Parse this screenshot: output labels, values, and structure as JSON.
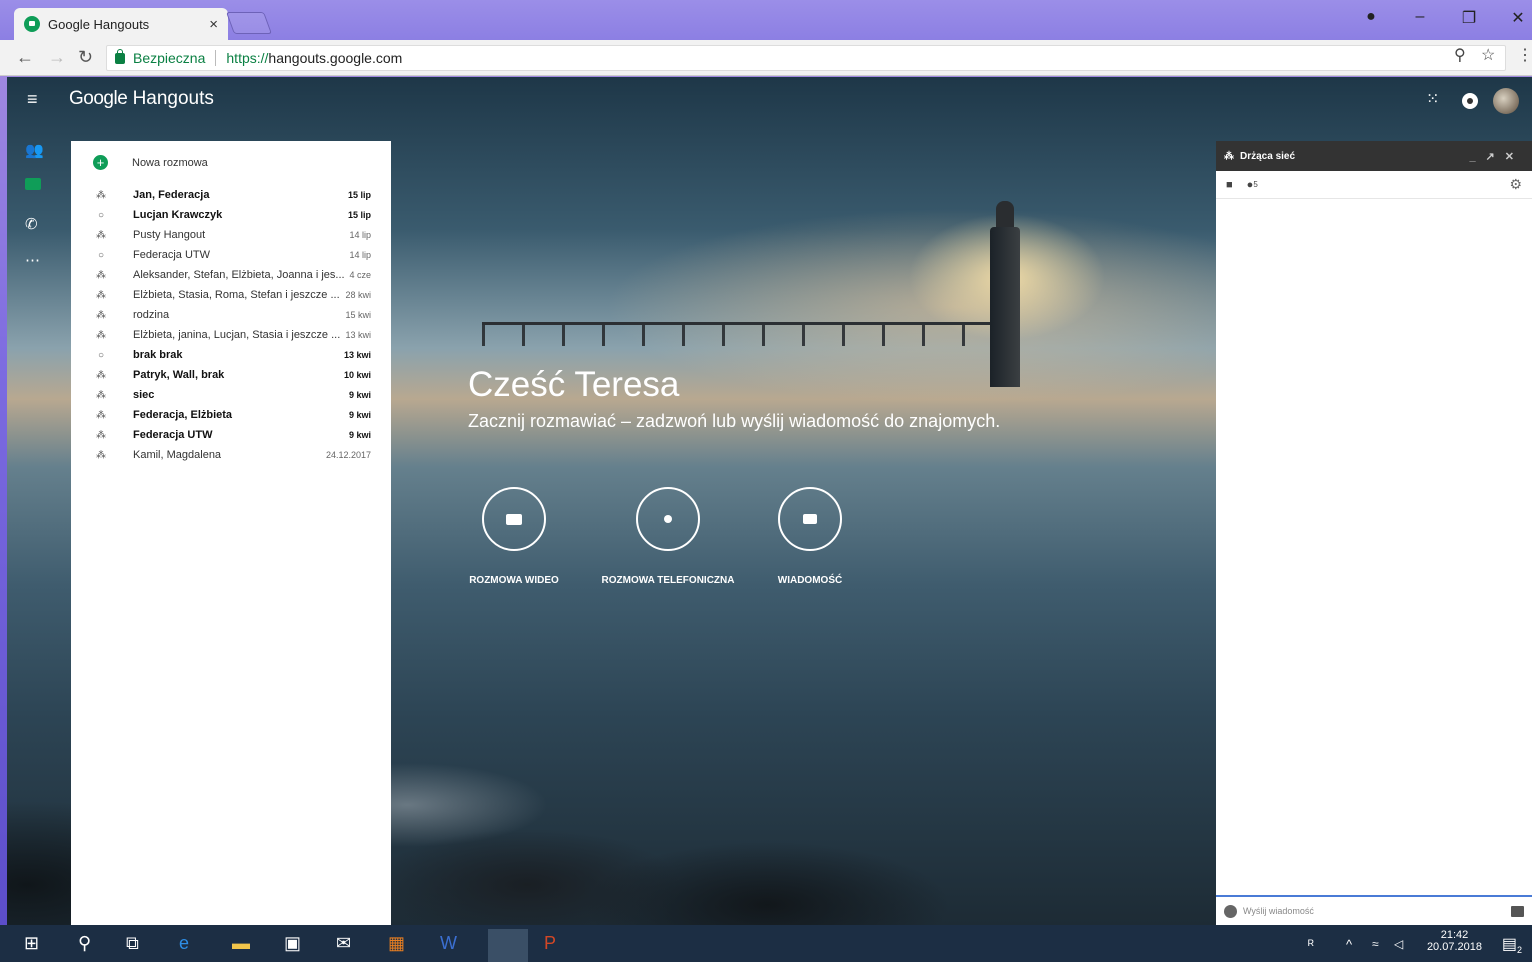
{
  "browser": {
    "tab_title": "Google Hangouts",
    "tab_close": "×",
    "secure_label": "Bezpieczna",
    "url_scheme": "https://",
    "url_host": "hangouts.google.com"
  },
  "app": {
    "brand_google": "Google",
    "brand_name": "Hangouts"
  },
  "sidebar": {
    "new_conversation": "Nowa rozmowa",
    "conversations": [
      {
        "name": "Jan, Federacja",
        "date": "15 lip",
        "icon": "group-icon",
        "unread": true
      },
      {
        "name": "Lucjan Krawczyk",
        "date": "15 lip",
        "icon": "person-circle-icon",
        "unread": true
      },
      {
        "name": "Pusty Hangout",
        "date": "14 lip",
        "icon": "group-icon",
        "unread": false
      },
      {
        "name": "Federacja UTW",
        "date": "14 lip",
        "icon": "person-circle-icon",
        "unread": false
      },
      {
        "name": "Aleksander, Stefan, Elżbieta, Joanna i jes...",
        "date": "4 cze",
        "icon": "group-icon",
        "unread": false
      },
      {
        "name": "Elżbieta, Stasia, Roma, Stefan i jeszcze ...",
        "date": "28 kwi",
        "icon": "group-icon",
        "unread": false
      },
      {
        "name": "rodzina",
        "date": "15 kwi",
        "icon": "group-icon",
        "unread": false
      },
      {
        "name": "Elżbieta, janina, Lucjan, Stasia i jeszcze ...",
        "date": "13 kwi",
        "icon": "group-icon",
        "unread": false
      },
      {
        "name": "brak brak",
        "date": "13 kwi",
        "icon": "person-circle-icon",
        "unread": true
      },
      {
        "name": "Patryk, Wall, brak",
        "date": "10 kwi",
        "icon": "group-icon",
        "unread": true
      },
      {
        "name": "siec",
        "date": "9 kwi",
        "icon": "group-icon",
        "unread": true
      },
      {
        "name": "Federacja, Elżbieta",
        "date": "9 kwi",
        "icon": "group-icon",
        "unread": true
      },
      {
        "name": "Federacja UTW",
        "date": "9 kwi",
        "icon": "group-icon",
        "unread": true
      },
      {
        "name": "Kamil, Magdalena",
        "date": "24.12.2017",
        "icon": "group-icon",
        "unread": false
      }
    ]
  },
  "welcome": {
    "greeting": "Cześć Teresa",
    "subtitle": "Zacznij rozmawiać – zadzwoń lub wyślij wiadomość do znajomych.",
    "actions": [
      {
        "label": "ROZMOWA WIDEO",
        "icon": "video-icon"
      },
      {
        "label": "ROZMOWA TELEFONICZNA",
        "icon": "phone-icon"
      },
      {
        "label": "WIADOMOŚĆ",
        "icon": "message-icon"
      }
    ]
  },
  "chat": {
    "title": "Drżąca sieć",
    "participants": "5",
    "input_placeholder": "Wyślij wiadomość"
  },
  "taskbar": {
    "time": "21:42",
    "date": "20.07.2018",
    "notifications": "2"
  }
}
